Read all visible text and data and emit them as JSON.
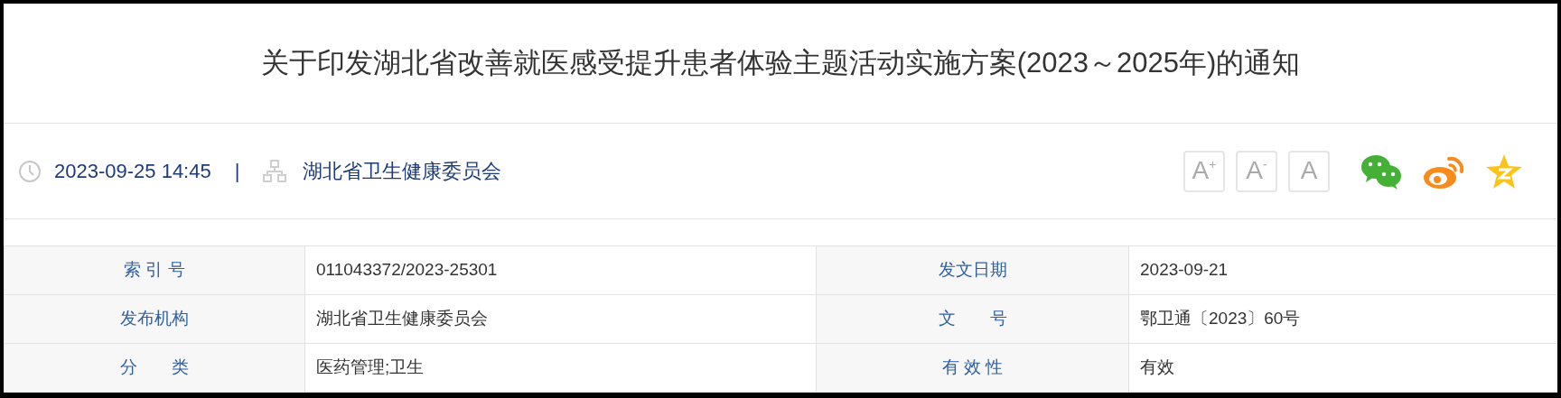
{
  "title": "关于印发湖北省改善就医感受提升患者体验主题活动实施方案(2023～2025年)的通知",
  "meta": {
    "datetime": "2023-09-25 14:45",
    "separator": "|",
    "publisher": "湖北省卫生健康委员会"
  },
  "font_buttons": [
    {
      "label": "A",
      "mark": "+"
    },
    {
      "label": "A",
      "mark": "-"
    },
    {
      "label": "A"
    }
  ],
  "share": [
    {
      "kind": "wechat"
    },
    {
      "kind": "weibo"
    },
    {
      "kind": "qzone"
    }
  ],
  "info_table": [
    [
      {
        "label": "索 引 号",
        "value": "011043372/2023-25301"
      },
      {
        "label": "发文日期",
        "value": "2023-09-21"
      }
    ],
    [
      {
        "label": "发布机构",
        "value": "湖北省卫生健康委员会"
      },
      {
        "label": "文　　号",
        "value": "鄂卫通〔2023〕60号"
      }
    ],
    [
      {
        "label": "分　　类",
        "value": "医药管理;卫生"
      },
      {
        "label": "有 效 性",
        "value": "有效"
      }
    ]
  ]
}
